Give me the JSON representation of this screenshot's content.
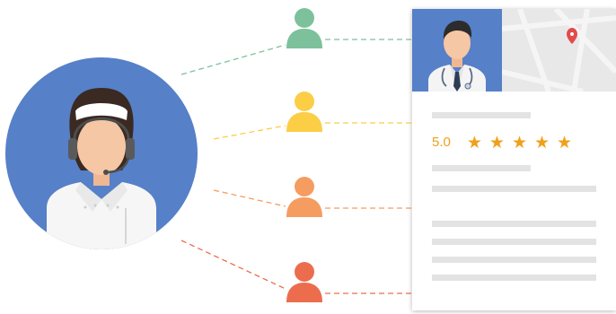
{
  "colors": {
    "agent_circle": "#5680c8",
    "agent_hair": "#3a2a22",
    "skin": "#f6c7a4",
    "card_header": "#5680c8",
    "map_bg": "#e8e8e8",
    "map_pin": "#e24b4b",
    "star": "#f1a01a",
    "placeholder_line": "#e3e3e3",
    "caller_green": "#7cc19c",
    "caller_yellow": "#fbce46",
    "caller_orange": "#f59c61",
    "caller_red": "#ec6d4e"
  },
  "agent": {
    "icon": "call-center-agent-with-headset"
  },
  "doctor": {
    "icon": "doctor-with-stethoscope"
  },
  "map": {
    "icon": "map-pin-icon"
  },
  "callers": [
    {
      "icon": "person-icon",
      "color": "#7cc19c"
    },
    {
      "icon": "person-icon",
      "color": "#fbce46"
    },
    {
      "icon": "person-icon",
      "color": "#f59c61"
    },
    {
      "icon": "person-icon",
      "color": "#ec6d4e"
    }
  ],
  "profile_card": {
    "rating_value": "5.0",
    "stars": [
      "★",
      "★",
      "★",
      "★",
      "★"
    ],
    "rating_count": 5
  }
}
